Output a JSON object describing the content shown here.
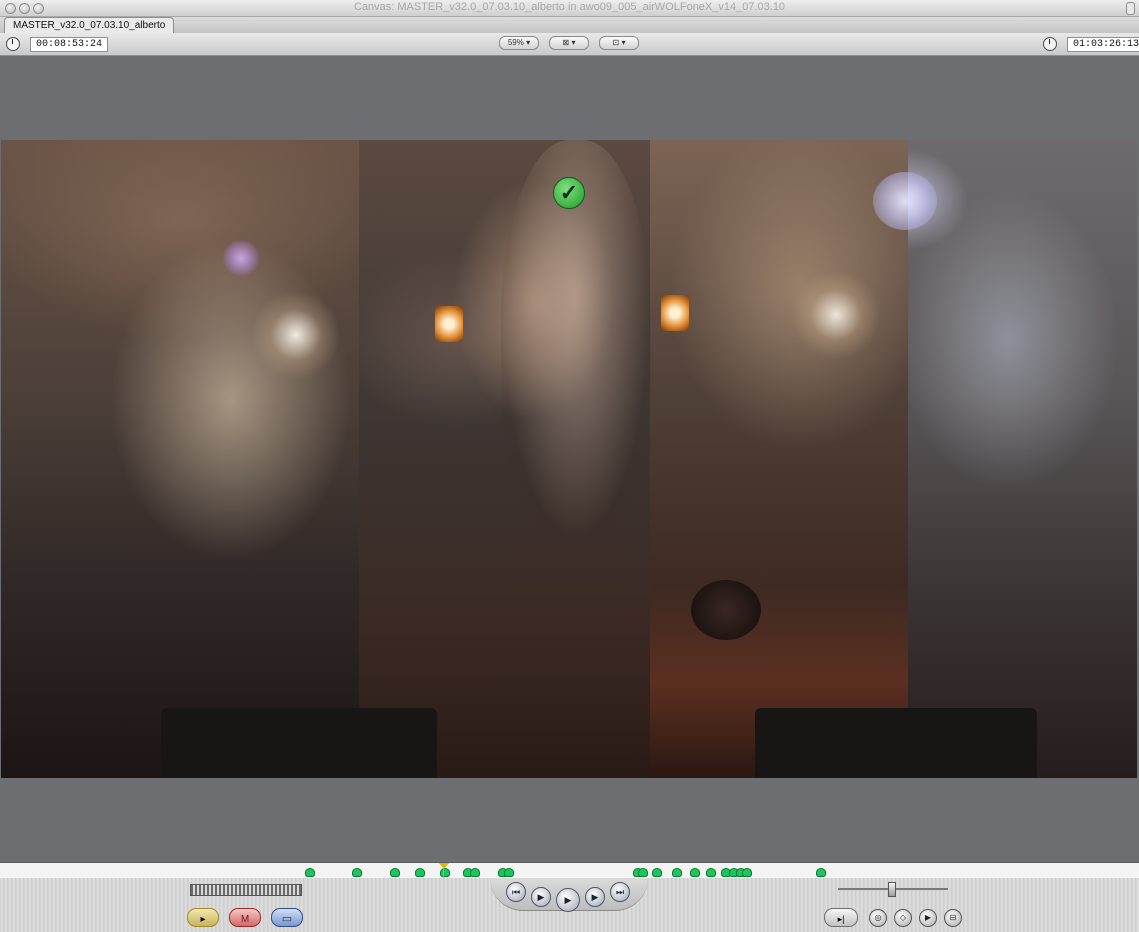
{
  "window": {
    "title": "Canvas: MASTER_v32.0_07.03.10_alberto in awo09_005_airWOLFoneX_v14_07.03.10"
  },
  "tab": {
    "label": "MASTER_v32.0_07.03.10_alberto"
  },
  "toolbar": {
    "duration_timecode": "00:08:53:24",
    "zoom_label": "59%",
    "view_label": "⊠",
    "overlay_label": "⊡",
    "current_timecode": "01:03:26:13"
  },
  "video": {
    "status_icon": "checkmark-icon",
    "status_color": "#1f9a28"
  },
  "scrubber": {
    "marker_color": "#19c85a",
    "playhead_color": "#d8b800"
  },
  "transport": {
    "prev_edit": "⏮",
    "play_in_out": "▶",
    "play": "▶",
    "play_around": "▶",
    "next_edit": "⏭"
  },
  "edit_buttons": {
    "insert": "▸",
    "overwrite": "M",
    "replace": "▭"
  },
  "right_controls": {
    "match_frame": "▸|",
    "mark_clip": "◎",
    "add_keyframe": "◇",
    "add_marker": "▶",
    "mark_in_out": "⊟"
  }
}
